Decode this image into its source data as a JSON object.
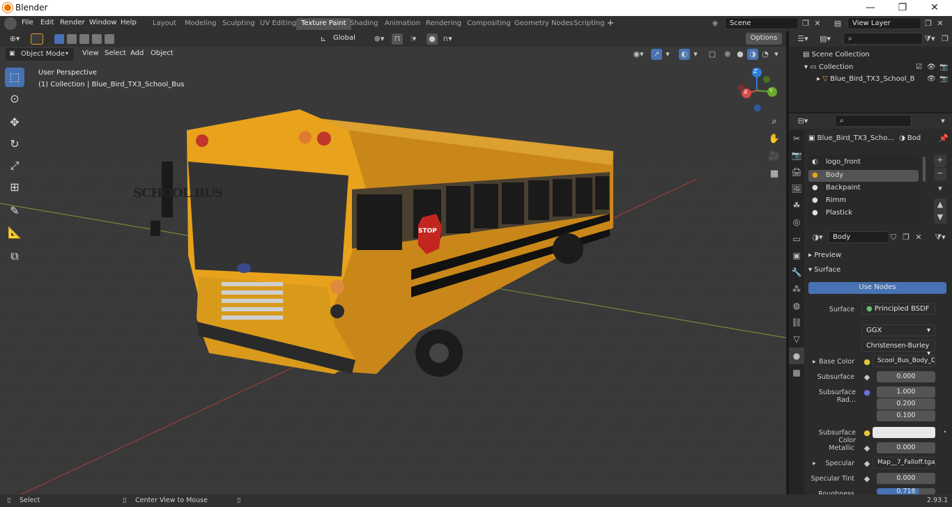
{
  "window": {
    "title": "Blender",
    "min": "—",
    "max": "❐",
    "close": "✕"
  },
  "menus": [
    "File",
    "Edit",
    "Render",
    "Window",
    "Help"
  ],
  "workspaces": [
    {
      "label": "Layout"
    },
    {
      "label": "Modeling"
    },
    {
      "label": "Sculpting"
    },
    {
      "label": "UV Editing"
    },
    {
      "label": "Texture Paint",
      "active": true
    },
    {
      "label": "Shading"
    },
    {
      "label": "Animation"
    },
    {
      "label": "Rendering"
    },
    {
      "label": "Compositing"
    },
    {
      "label": "Geometry Nodes"
    },
    {
      "label": "Scripting"
    }
  ],
  "scene": {
    "name": "Scene",
    "view_layer": "View Layer"
  },
  "toolbar": {
    "transform_orientation": "Global",
    "options": "Options"
  },
  "viewport_header": {
    "mode": "Object Mode",
    "menus": [
      "View",
      "Select",
      "Add",
      "Object"
    ]
  },
  "viewport": {
    "perspective_label": "User Perspective",
    "collection_label": "(1) Collection | Blue_Bird_TX3_School_Bus",
    "bus_text": "SCHOOL BUS",
    "stop_text": "STOP"
  },
  "gizmo": {
    "z": "Z",
    "x": "X",
    "y": "Y"
  },
  "outliner": {
    "scene_collection": "Scene Collection",
    "collection": "Collection",
    "object": "Blue_Bird_TX3_School_B"
  },
  "properties": {
    "object_name": "Blue_Bird_TX3_Scho...",
    "material_short": "Bod",
    "material_slots": [
      {
        "name": "logo_front"
      },
      {
        "name": "Body",
        "selected": true
      },
      {
        "name": "Backpaint"
      },
      {
        "name": "Rimm"
      },
      {
        "name": "Plastick"
      }
    ],
    "material_name": "Body",
    "panels": {
      "preview": "Preview",
      "surface": "Surface"
    },
    "use_nodes": "Use Nodes",
    "surface_label": "Surface",
    "surface_value": "Principled BSDF",
    "distribution": "GGX",
    "subsurface_method": "Christensen-Burley",
    "fields": {
      "base_color": {
        "label": "Base Color",
        "value": "Scool_Bus_Body_Dif..."
      },
      "subsurface": {
        "label": "Subsurface",
        "value": "0.000"
      },
      "subsurface_radius": {
        "label": "Subsurface Rad...",
        "values": [
          "1.000",
          "0.200",
          "0.100"
        ]
      },
      "subsurface_color": {
        "label": "Subsurface Color"
      },
      "metallic": {
        "label": "Metallic",
        "value": "0.000"
      },
      "specular": {
        "label": "Specular",
        "value": "Map__7_Falloff.tga"
      },
      "specular_tint": {
        "label": "Specular Tint",
        "value": "0.000"
      },
      "roughness": {
        "label": "Roughness",
        "value": "0.718"
      }
    }
  },
  "status": {
    "select": "Select",
    "center": "Center View to Mouse",
    "version": "2.93.1"
  },
  "colors": {
    "accent": "#4772b3",
    "bus_yellow": "#e8a21c",
    "brand": "#ea7600"
  }
}
